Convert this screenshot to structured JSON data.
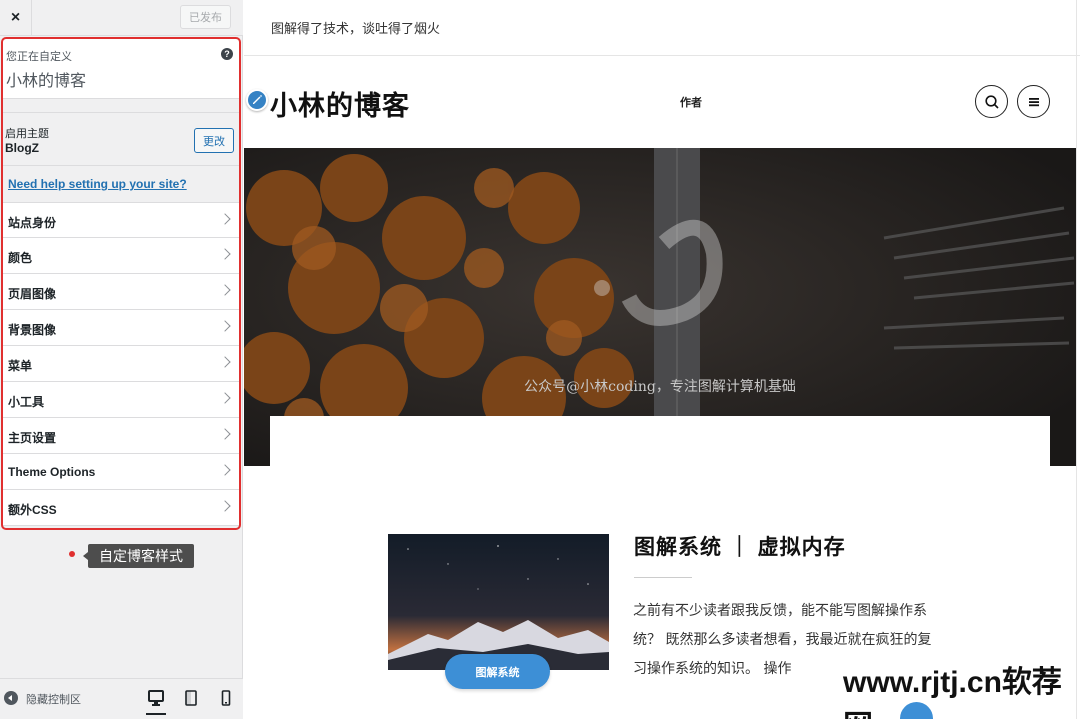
{
  "topbar": {
    "close": "×",
    "publish_label": "已发布"
  },
  "customizing": {
    "label": "您正在自定义",
    "site_title": "小林的博客",
    "help": "?"
  },
  "theme": {
    "label": "启用主题",
    "name": "BlogZ",
    "change_label": "更改"
  },
  "help_link": "Need help setting up your site?",
  "menu": [
    {
      "label": "站点身份"
    },
    {
      "label": "颜色"
    },
    {
      "label": "页眉图像"
    },
    {
      "label": "背景图像"
    },
    {
      "label": "菜单"
    },
    {
      "label": "小工具"
    },
    {
      "label": "主页设置"
    },
    {
      "label": "Theme Options"
    },
    {
      "label": "额外CSS"
    }
  ],
  "annotation": "自定博客样式",
  "footer": {
    "collapse_label": "隐藏控制区",
    "devices": [
      {
        "icon": "desktop-icon",
        "active": true
      },
      {
        "icon": "tablet-icon",
        "active": false
      },
      {
        "icon": "mobile-icon",
        "active": false
      }
    ]
  },
  "preview": {
    "tagline": "图解得了技术，谈吐得了烟火",
    "site_title": "小林的博客",
    "nav_item": "作者",
    "hero_caption": "公众号@小林coding，专注图解计算机基础",
    "post": {
      "category": "图解系统",
      "title": "图解系统 ｜ 虚拟内存",
      "excerpt": "之前有不少读者跟我反馈，能不能写图解操作系统？ 既然那么多读者想看，我最近就在疯狂的复习操作系统的知识。 操作"
    }
  },
  "watermark": "www.rjtj.cn软荐网",
  "colors": {
    "accent": "#3d8fd6",
    "highlight_frame": "#e02f2f",
    "wp_blue": "#2271b1"
  }
}
